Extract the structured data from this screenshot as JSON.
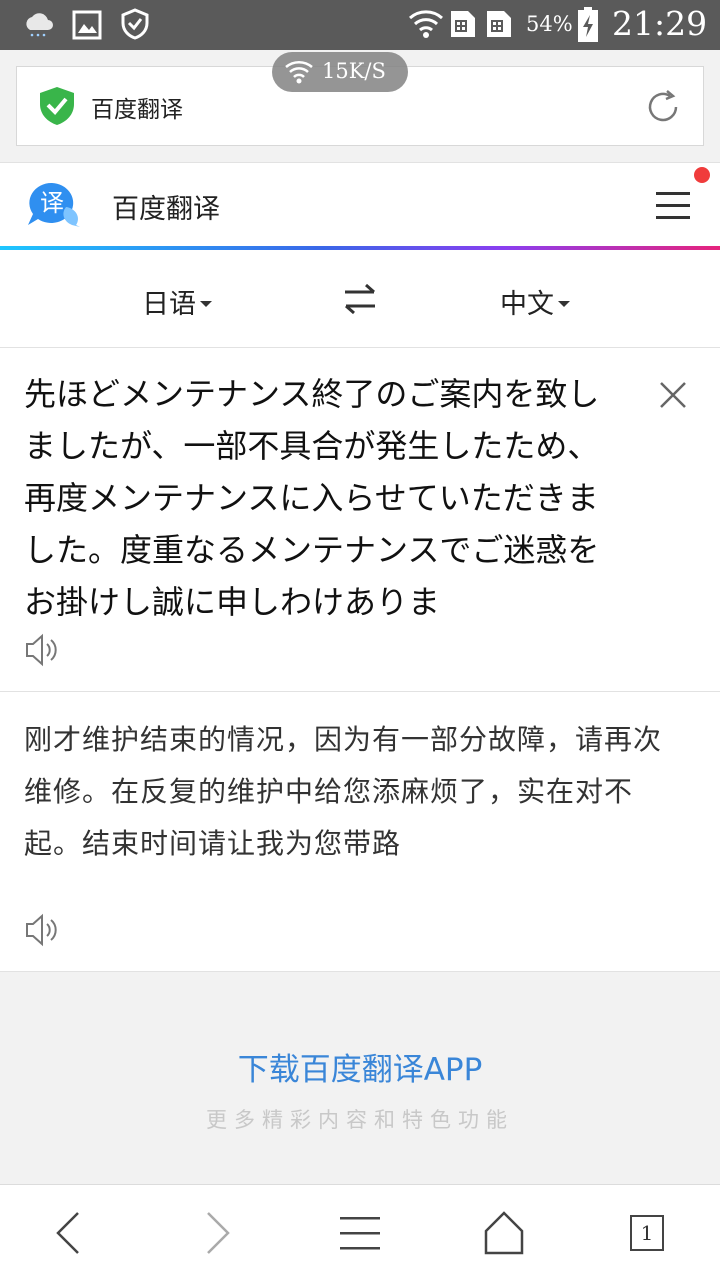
{
  "status_bar": {
    "battery_percent": "54%",
    "time": "21:29",
    "icons": [
      "cloud-rain-icon",
      "image-icon",
      "shield-check-icon",
      "wifi-icon",
      "sim-card-icon",
      "sim-card-icon",
      "battery-charging-icon"
    ]
  },
  "browser": {
    "site_name": "百度翻译",
    "network_speed": "15K/S",
    "secure_color": "#39b54a"
  },
  "app": {
    "title": "百度翻译",
    "logo_char": "译",
    "notification_dot_color": "#f03c3c"
  },
  "languages": {
    "source": "日语",
    "target": "中文"
  },
  "source_panel": {
    "text": "先ほどメンテナンス終了のご案内を致しましたが、一部不具合が発生したため、再度メンテナンスに入らせていただきました。度重なるメンテナンスでご迷惑をお掛けし誠に申しわけありま"
  },
  "target_panel": {
    "text": "刚才维护结束的情况，因为有一部分故障，请再次维修。在反复的维护中给您添麻烦了，实在对不起。结束时间请让我为您带路"
  },
  "promo": {
    "title": "下载百度翻译APP",
    "subtitle": "更多精彩内容和特色功能"
  },
  "bottom_nav": {
    "tab_count": "1"
  }
}
